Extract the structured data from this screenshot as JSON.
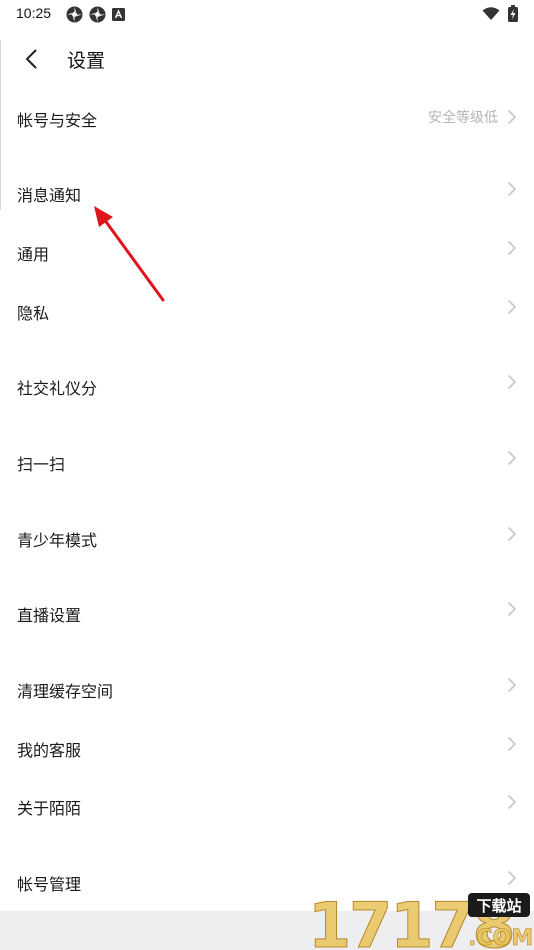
{
  "status_bar": {
    "time": "10:25"
  },
  "header": {
    "title": "设置"
  },
  "settings": {
    "items": [
      {
        "label": "帐号与安全",
        "value": "安全等级低"
      },
      {
        "label": "消息通知",
        "value": ""
      },
      {
        "label": "通用",
        "value": ""
      },
      {
        "label": "隐私",
        "value": ""
      },
      {
        "label": "社交礼仪分",
        "value": ""
      },
      {
        "label": "扫一扫",
        "value": ""
      },
      {
        "label": "青少年模式",
        "value": ""
      },
      {
        "label": "直播设置",
        "value": ""
      },
      {
        "label": "清理缓存空间",
        "value": ""
      },
      {
        "label": "我的客服",
        "value": ""
      },
      {
        "label": "关于陌陌",
        "value": ""
      },
      {
        "label": "帐号管理",
        "value": ""
      }
    ]
  },
  "watermark": {
    "digits": "17178",
    "badge": "下载站",
    "suffix": ".COM"
  },
  "colors": {
    "accent_arrow": "#e0151c",
    "watermark_gold": "#e8c35a",
    "chevron": "#c6c6c6",
    "value_grey": "#b5b5b5"
  }
}
